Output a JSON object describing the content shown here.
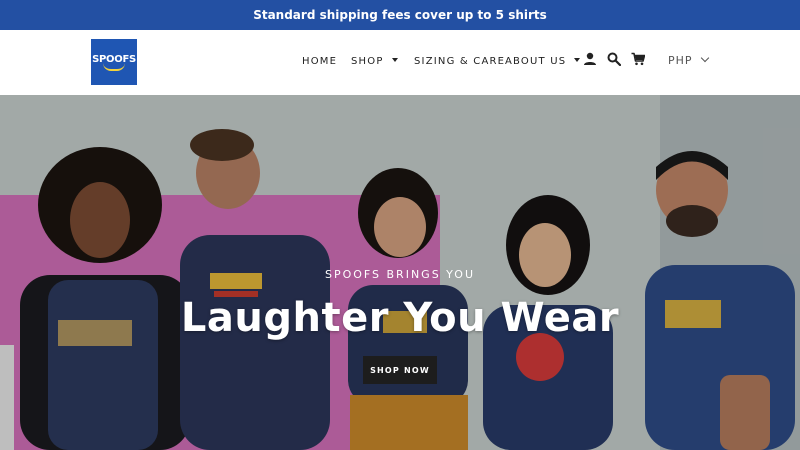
{
  "announcement": "Standard shipping fees cover up to 5 shirts",
  "logo": {
    "text": "SPOOFS"
  },
  "nav": {
    "home": "HOME",
    "shop": "SHOP",
    "sizing": "SIZING & CARE",
    "about": "ABOUT US"
  },
  "header_icons": [
    "account-icon",
    "search-icon",
    "cart-icon"
  ],
  "currency": "PHP",
  "hero": {
    "kicker": "SPOOFS BRINGS YOU",
    "title": "Laughter You Wear",
    "button": "SHOP NOW"
  },
  "colors": {
    "announcement_bg": "#2350a3",
    "logo_bg": "#1f56b3",
    "button_bg": "#1d1d1d"
  }
}
